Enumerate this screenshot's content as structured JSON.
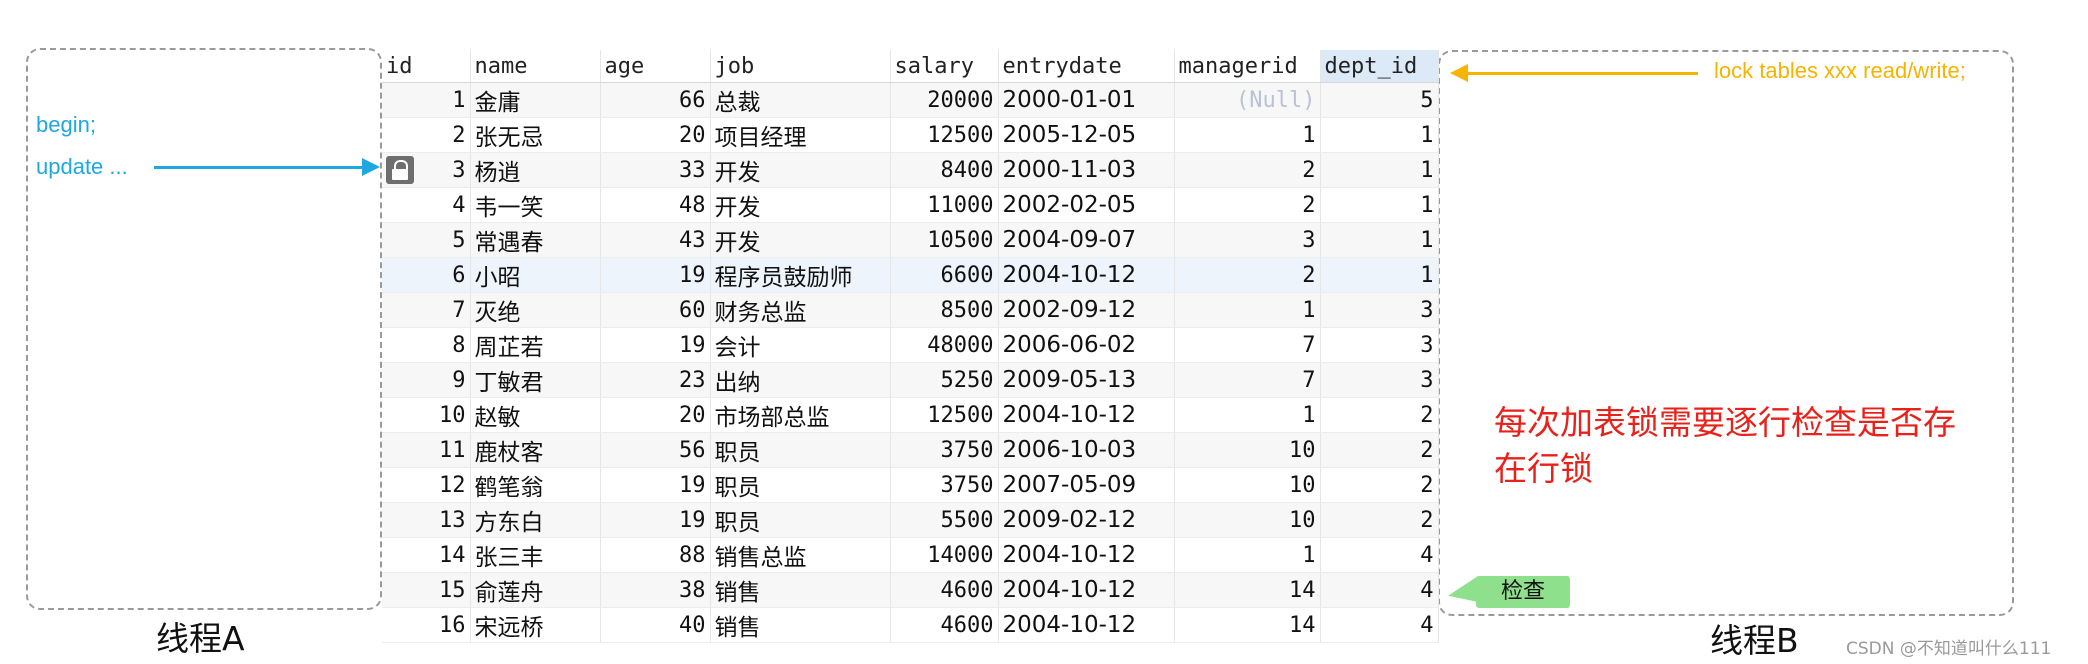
{
  "thread_a": {
    "caption": "线程A",
    "begin": "begin;",
    "update": "update ..."
  },
  "thread_b": {
    "caption": "线程B",
    "lock_statement": "lock tables xxx read/write;",
    "note": "每次加表锁需要逐行检查是否存在行锁",
    "check_badge": "检查"
  },
  "colors": {
    "thread_a_arrow": "#1fa7e0",
    "thread_b_arrow": "#f5b400",
    "note": "#e8221a",
    "badge": "#8fe08c",
    "selected_header": "#dce9f7"
  },
  "table": {
    "columns": [
      "id",
      "name",
      "age",
      "job",
      "salary",
      "entrydate",
      "managerid",
      "dept_id"
    ],
    "selected_column": "dept_id",
    "locked_row_id": "3",
    "rows": [
      {
        "id": "1",
        "name": "金庸",
        "age": "66",
        "job": "总裁",
        "salary": "20000",
        "entrydate": "2000-01-01",
        "managerid": "(Null)",
        "dept_id": "5"
      },
      {
        "id": "2",
        "name": "张无忌",
        "age": "20",
        "job": "项目经理",
        "salary": "12500",
        "entrydate": "2005-12-05",
        "managerid": "1",
        "dept_id": "1"
      },
      {
        "id": "3",
        "name": "杨逍",
        "age": "33",
        "job": "开发",
        "salary": "8400",
        "entrydate": "2000-11-03",
        "managerid": "2",
        "dept_id": "1"
      },
      {
        "id": "4",
        "name": "韦一笑",
        "age": "48",
        "job": "开发",
        "salary": "11000",
        "entrydate": "2002-02-05",
        "managerid": "2",
        "dept_id": "1"
      },
      {
        "id": "5",
        "name": "常遇春",
        "age": "43",
        "job": "开发",
        "salary": "10500",
        "entrydate": "2004-09-07",
        "managerid": "3",
        "dept_id": "1"
      },
      {
        "id": "6",
        "name": "小昭",
        "age": "19",
        "job": "程序员鼓励师",
        "salary": "6600",
        "entrydate": "2004-10-12",
        "managerid": "2",
        "dept_id": "1"
      },
      {
        "id": "7",
        "name": "灭绝",
        "age": "60",
        "job": "财务总监",
        "salary": "8500",
        "entrydate": "2002-09-12",
        "managerid": "1",
        "dept_id": "3"
      },
      {
        "id": "8",
        "name": "周芷若",
        "age": "19",
        "job": "会计",
        "salary": "48000",
        "entrydate": "2006-06-02",
        "managerid": "7",
        "dept_id": "3"
      },
      {
        "id": "9",
        "name": "丁敏君",
        "age": "23",
        "job": "出纳",
        "salary": "5250",
        "entrydate": "2009-05-13",
        "managerid": "7",
        "dept_id": "3"
      },
      {
        "id": "10",
        "name": "赵敏",
        "age": "20",
        "job": "市场部总监",
        "salary": "12500",
        "entrydate": "2004-10-12",
        "managerid": "1",
        "dept_id": "2"
      },
      {
        "id": "11",
        "name": "鹿杖客",
        "age": "56",
        "job": "职员",
        "salary": "3750",
        "entrydate": "2006-10-03",
        "managerid": "10",
        "dept_id": "2"
      },
      {
        "id": "12",
        "name": "鹤笔翁",
        "age": "19",
        "job": "职员",
        "salary": "3750",
        "entrydate": "2007-05-09",
        "managerid": "10",
        "dept_id": "2"
      },
      {
        "id": "13",
        "name": "方东白",
        "age": "19",
        "job": "职员",
        "salary": "5500",
        "entrydate": "2009-02-12",
        "managerid": "10",
        "dept_id": "2"
      },
      {
        "id": "14",
        "name": "张三丰",
        "age": "88",
        "job": "销售总监",
        "salary": "14000",
        "entrydate": "2004-10-12",
        "managerid": "1",
        "dept_id": "4"
      },
      {
        "id": "15",
        "name": "俞莲舟",
        "age": "38",
        "job": "销售",
        "salary": "4600",
        "entrydate": "2004-10-12",
        "managerid": "14",
        "dept_id": "4"
      },
      {
        "id": "16",
        "name": "宋远桥",
        "age": "40",
        "job": "销售",
        "salary": "4600",
        "entrydate": "2004-10-12",
        "managerid": "14",
        "dept_id": "4"
      }
    ]
  },
  "footer": "CSDN @不知道叫什么111"
}
